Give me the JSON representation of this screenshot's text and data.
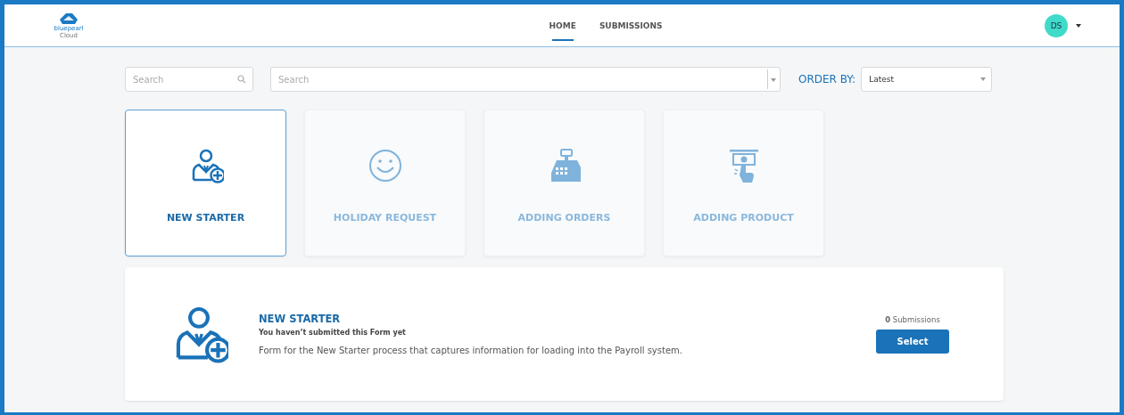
{
  "header": {
    "logo": {
      "name": "bluepearl",
      "sub": "Cloud"
    },
    "nav": [
      {
        "label": "HOME",
        "selected": true
      },
      {
        "label": "SUBMISSIONS",
        "selected": false
      }
    ],
    "user": {
      "initials": "DS"
    }
  },
  "filters": {
    "search": {
      "placeholder": "Search"
    },
    "category": {
      "placeholder": "Search"
    },
    "order_by": {
      "label": "ORDER BY:",
      "value": "Latest"
    }
  },
  "forms": [
    {
      "title": "NEW STARTER",
      "kind": "person",
      "selected": true
    },
    {
      "title": "HOLIDAY REQUEST",
      "kind": "smiley",
      "selected": false
    },
    {
      "title": "ADDING ORDERS",
      "kind": "register",
      "selected": false
    },
    {
      "title": "ADDING PRODUCT",
      "kind": "atm",
      "selected": false
    }
  ],
  "detail": {
    "kind": "person",
    "title": "NEW STARTER",
    "status": "You haven’t submitted this Form yet",
    "description": "Form for the New Starter process that captures information for loading into the Payroll system.",
    "submissions": "**0** Submissions",
    "button": "Select"
  }
}
